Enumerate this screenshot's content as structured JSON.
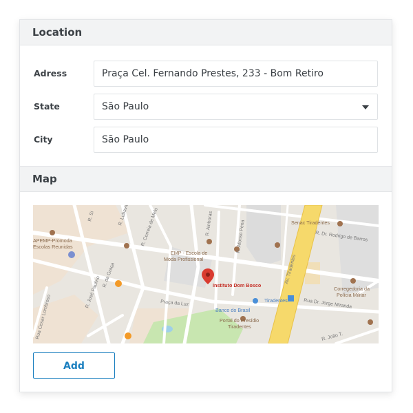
{
  "location": {
    "title": "Location",
    "address_label": "Adress",
    "address_value": "Praça Cel. Fernando Prestes, 233 - Bom Retiro",
    "state_label": "State",
    "state_value": "São Paulo",
    "city_label": "City",
    "city_value": "São Paulo"
  },
  "map_section": {
    "title": "Map",
    "labels": {
      "senac": "Senac Tiradentes",
      "apemp": "APEMP-Promoda",
      "apemp2": "Escolas Reunidas",
      "emp": "EMP - Escola de",
      "emp2": "Moda Profissional",
      "marker": "Instituto Dom Bosco",
      "corregedoria": "Corregedoria da",
      "corregedoria2": "Polícia Militar",
      "banco": "Banco do Brasil",
      "tiradentes_station": "Tiradentes",
      "portal": "Portal do Presídio",
      "portal2": "Tiradentes",
      "praca_luz": "Praça da Luz",
      "av_tiradentes": "Av. Tiradentes",
      "rua_rodrigo": "R. Dr. Rodrigo de Barros",
      "rua_jorge": "Rua Dr. Jorge Miranda",
      "rua_joao": "R. João T.",
      "rua_afonso": "R. Afonso Pena",
      "rua_ainhoras": "R. Ainhoras",
      "rua_correia": "R. Correia de Melo",
      "rua_graca": "R. da Graça",
      "rua_jose": "R. José Paulino",
      "rua_cesar": "Rua Cesar Lombroso",
      "rua_lubavich": "R. Lubavich",
      "rua_si": "R. Si"
    }
  },
  "actions": {
    "add_label": "Add"
  },
  "colors": {
    "accent": "#1a7fbf",
    "marker": "#d93b30",
    "highway": "#f6d96b",
    "park": "#c8e6b0"
  }
}
